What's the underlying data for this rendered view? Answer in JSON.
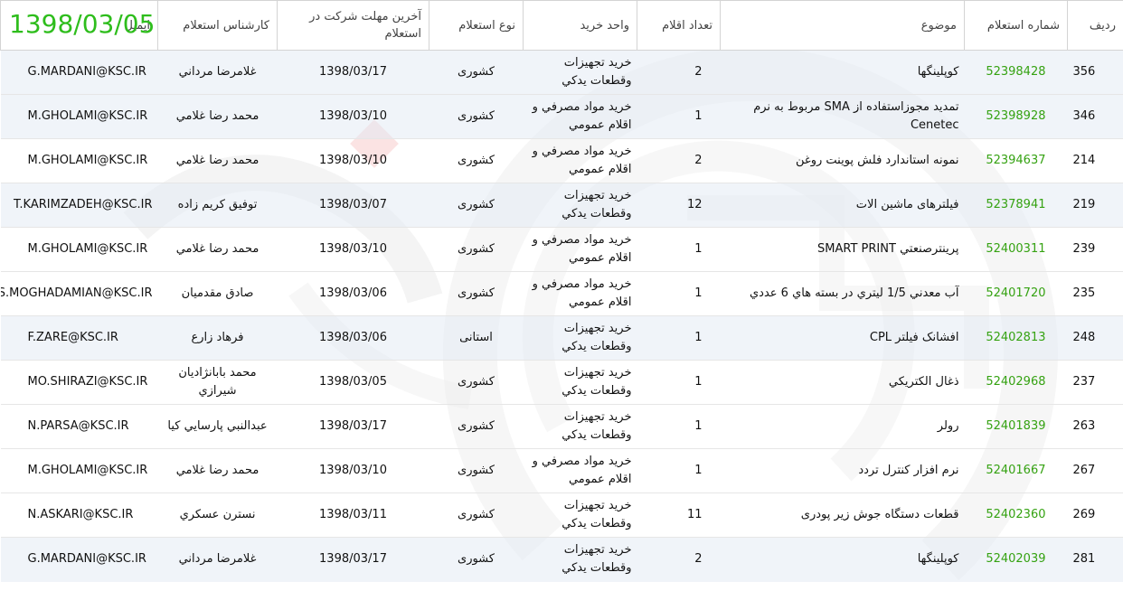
{
  "overlay_date": "1398/03/05",
  "colors": {
    "number_green": "#35a212",
    "overlay_green": "#2ebd1c",
    "watermark_red": "#e34b4b"
  },
  "headers": {
    "radif": "ردیف",
    "shomare": "شماره استعلام",
    "mozoo": "موضوع",
    "tedad": "تعداد اقلام",
    "vahed": "واحد خرید",
    "noe": "نوع استعلام",
    "mohlat": "آخرین مهلت شرکت در استعلام",
    "karshenas": "کارشناس استعلام",
    "email": "ایمیل"
  },
  "rows": [
    {
      "radif": "356",
      "number": "52398428",
      "subject": "کوپلینگها",
      "count": "2",
      "unit": "خرید تجهیزات وقطعات یدکي",
      "type": "کشوری",
      "deadline": "1398/03/17",
      "expert": "غلامرضا مرداني",
      "email": "G.MARDANI@KSC.IR"
    },
    {
      "radif": "346",
      "number": "52398928",
      "subject": "تمدید مجوزاستفاده از SMA مربوط به نرم Cenetec",
      "count": "1",
      "unit": "خرید مواد مصرفي و اقلام عمومي",
      "type": "کشوری",
      "deadline": "1398/03/10",
      "expert": "محمد رضا غلامي",
      "email": "M.GHOLAMI@KSC.IR"
    },
    {
      "radif": "214",
      "number": "52394637",
      "subject": "نمونه استاندارد فلش پوینت روغن",
      "count": "2",
      "unit": "خرید مواد مصرفي و اقلام عمومي",
      "type": "کشوری",
      "deadline": "1398/03/10",
      "expert": "محمد رضا غلامي",
      "email": "M.GHOLAMI@KSC.IR"
    },
    {
      "radif": "219",
      "number": "52378941",
      "subject": "فیلترهای ماشین الات",
      "count": "12",
      "unit": "خرید تجهیزات وقطعات یدکي",
      "type": "کشوری",
      "deadline": "1398/03/07",
      "expert": "توفیق کریم زاده",
      "email": "T.KARIMZADEH@KSC.IR"
    },
    {
      "radif": "239",
      "number": "52400311",
      "subject": "پرينترصنعتي SMART PRINT",
      "count": "1",
      "unit": "خرید مواد مصرفي و اقلام عمومي",
      "type": "کشوری",
      "deadline": "1398/03/10",
      "expert": "محمد رضا غلامي",
      "email": "M.GHOLAMI@KSC.IR"
    },
    {
      "radif": "235",
      "number": "52401720",
      "subject": "آب معدني 1/5 ليتري در بسته هاي 6 عددي",
      "count": "1",
      "unit": "خرید مواد مصرفي و اقلام عمومي",
      "type": "کشوری",
      "deadline": "1398/03/06",
      "expert": "صادق مقدميان",
      "email": "S.MOGHADAMIAN@KSC.IR"
    },
    {
      "radif": "248",
      "number": "52402813",
      "subject": "افشانک فیلتر CPL",
      "count": "1",
      "unit": "خرید تجهیزات وقطعات یدکي",
      "type": "استانی",
      "deadline": "1398/03/06",
      "expert": "فرهاد زارع",
      "email": "F.ZARE@KSC.IR"
    },
    {
      "radif": "237",
      "number": "52402968",
      "subject": "ذغال الکتریکي",
      "count": "1",
      "unit": "خرید تجهیزات وقطعات یدکي",
      "type": "کشوری",
      "deadline": "1398/03/05",
      "expert": "محمد بابانژادیان شیرازي",
      "email": "MO.SHIRAZI@KSC.IR"
    },
    {
      "radif": "263",
      "number": "52401839",
      "subject": "رولر",
      "count": "1",
      "unit": "خرید تجهیزات وقطعات یدکي",
      "type": "کشوری",
      "deadline": "1398/03/17",
      "expert": "عبدالنبي پارسايي کيا",
      "email": "N.PARSA@KSC.IR"
    },
    {
      "radif": "267",
      "number": "52401667",
      "subject": "نرم افزار کنترل تردد",
      "count": "1",
      "unit": "خرید مواد مصرفي و اقلام عمومي",
      "type": "کشوری",
      "deadline": "1398/03/10",
      "expert": "محمد رضا غلامي",
      "email": "M.GHOLAMI@KSC.IR"
    },
    {
      "radif": "269",
      "number": "52402360",
      "subject": "قطعات دستگاه جوش زیر پودری",
      "count": "11",
      "unit": "خرید تجهیزات وقطعات یدکي",
      "type": "کشوری",
      "deadline": "1398/03/11",
      "expert": "نسترن عسکري",
      "email": "N.ASKARI@KSC.IR"
    },
    {
      "radif": "281",
      "number": "52402039",
      "subject": "کوپلینگها",
      "count": "2",
      "unit": "خرید تجهیزات وقطعات یدکي",
      "type": "کشوری",
      "deadline": "1398/03/17",
      "expert": "غلامرضا مرداني",
      "email": "G.MARDANI@KSC.IR"
    }
  ]
}
